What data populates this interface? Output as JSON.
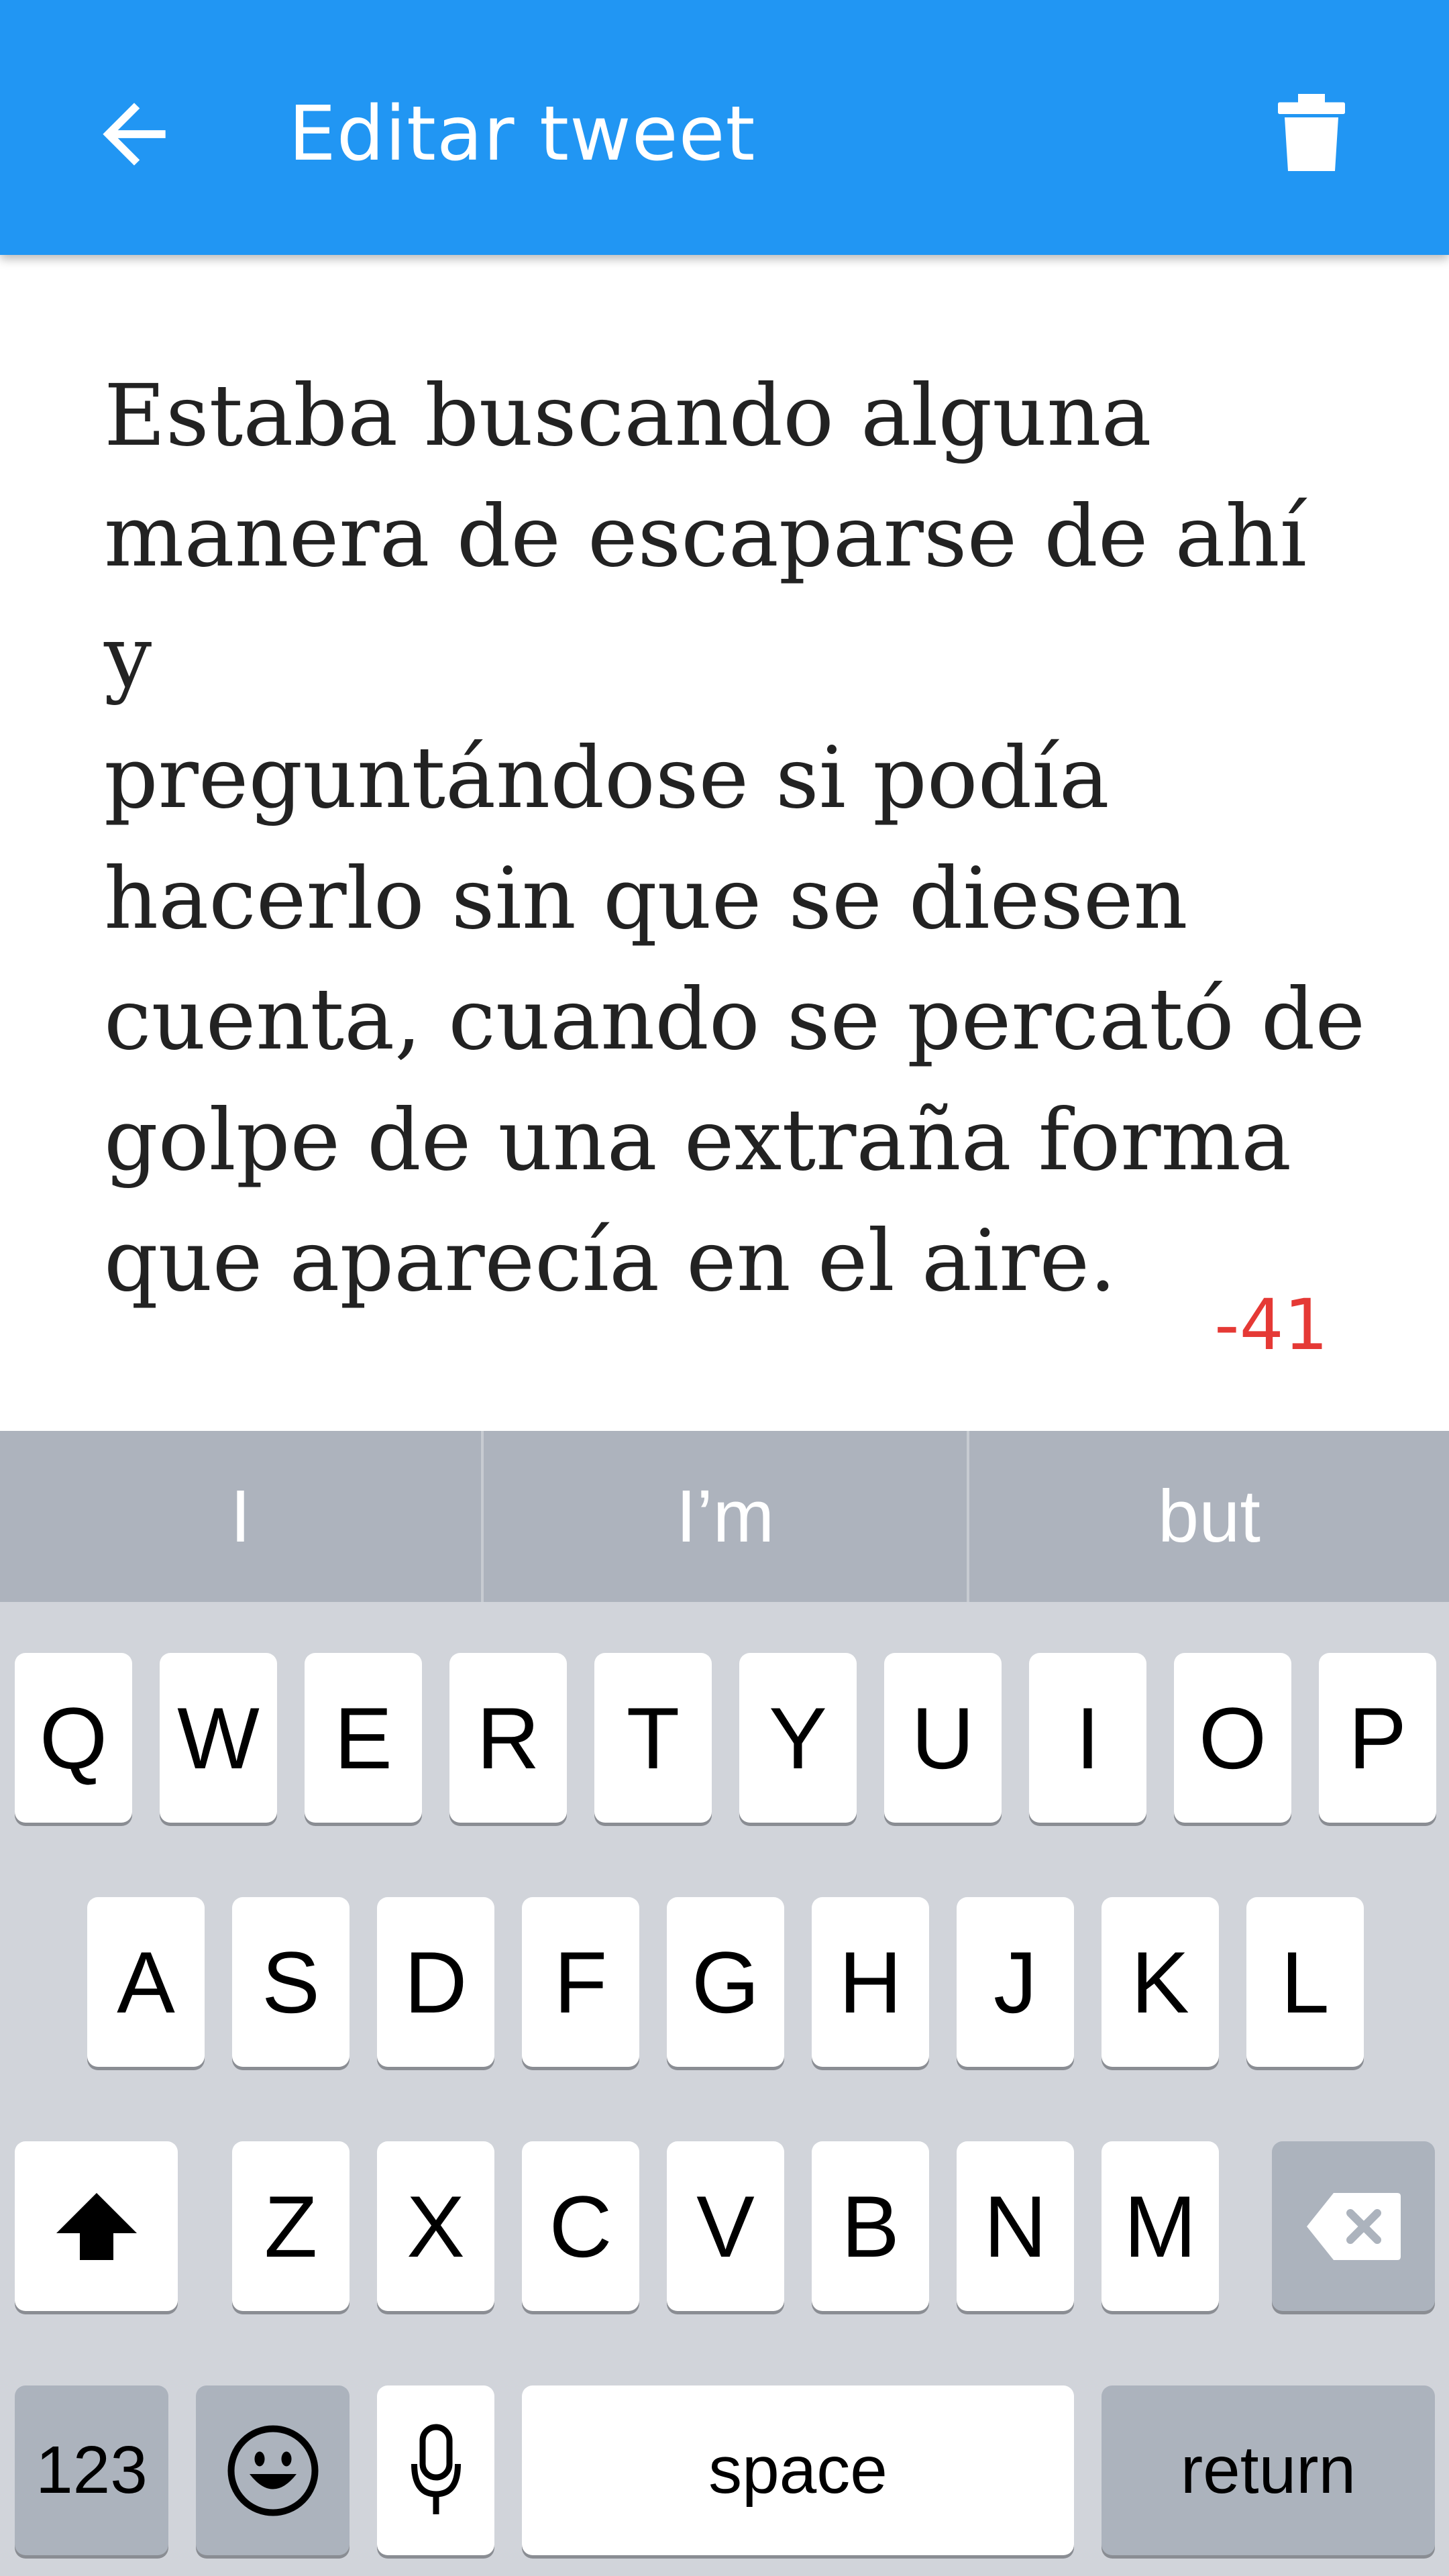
{
  "app_bar": {
    "title": "Editar tweet",
    "back_icon": "arrow-left-icon",
    "delete_icon": "trash-icon",
    "background": "#2196F3"
  },
  "tweet": {
    "lines": [
      "Estaba buscando alguna",
      "manera de escaparse de ahí y",
      "preguntándose si podía",
      "hacerlo sin que se diesen",
      "cuenta, cuando se percató de",
      "golpe de una extraña forma",
      "que aparecía en el aire."
    ],
    "text": "Estaba buscando alguna\nmanera de escaparse de ahí y\npreguntándose si podía\nhacerlo sin que se diesen\ncuenta, cuando se percató de\ngolpe de una extraña forma\nque aparecía en el aire.",
    "char_counter": "-41",
    "counter_color": "#E53935"
  },
  "keyboard": {
    "suggestions": [
      "I",
      "I’m",
      "but"
    ],
    "row1": [
      "Q",
      "W",
      "E",
      "R",
      "T",
      "Y",
      "U",
      "I",
      "O",
      "P"
    ],
    "row2": [
      "A",
      "S",
      "D",
      "F",
      "G",
      "H",
      "J",
      "K",
      "L"
    ],
    "row3": [
      "Z",
      "X",
      "C",
      "V",
      "B",
      "N",
      "M"
    ],
    "shift_icon": "shift-arrow-icon",
    "backspace_icon": "backspace-icon",
    "numbers_label": "123",
    "emoji_icon": "emoji-icon",
    "mic_icon": "microphone-icon",
    "space_label": "space",
    "return_label": "return"
  }
}
